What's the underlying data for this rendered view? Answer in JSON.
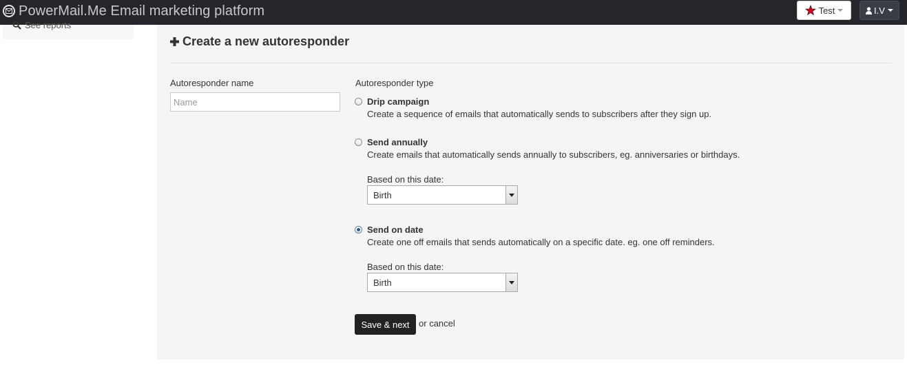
{
  "header": {
    "app_title": "PowerMail.Me Email marketing platform",
    "brand_prefix": "PowerMail.",
    "brand_suffix": "Me Email marketing platform",
    "test_button_label": "Test",
    "user_menu_label": "I.V"
  },
  "sidebar": {
    "items": [
      {
        "label": "See reports",
        "icon": "search-icon"
      }
    ]
  },
  "form": {
    "title": "Create a new autoresponder",
    "name_label": "Autoresponder name",
    "name_placeholder": "Name",
    "name_value": "",
    "type_label": "Autoresponder type",
    "options": [
      {
        "title": "Drip campaign",
        "description": "Create a sequence of emails that automatically sends to subscribers after they sign up.",
        "checked": false
      },
      {
        "title": "Send annually",
        "description": "Create emails that automatically sends annually to subscribers, eg. anniversaries or birthdays.",
        "checked": false,
        "date_label": "Based on this date:",
        "date_value": "Birth"
      },
      {
        "title": "Send on date",
        "description": "Create one off emails that sends automatically on a specific date. eg. one off reminders.",
        "checked": true,
        "date_label": "Based on this date:",
        "date_value": "Birth"
      }
    ],
    "save_button": "Save & next",
    "or_text": "or",
    "cancel_link": "cancel"
  },
  "colors": {
    "topbar": "#24262b",
    "panel": "#f5f5f5",
    "primary_button": "#222222",
    "star": "#d0021b"
  }
}
